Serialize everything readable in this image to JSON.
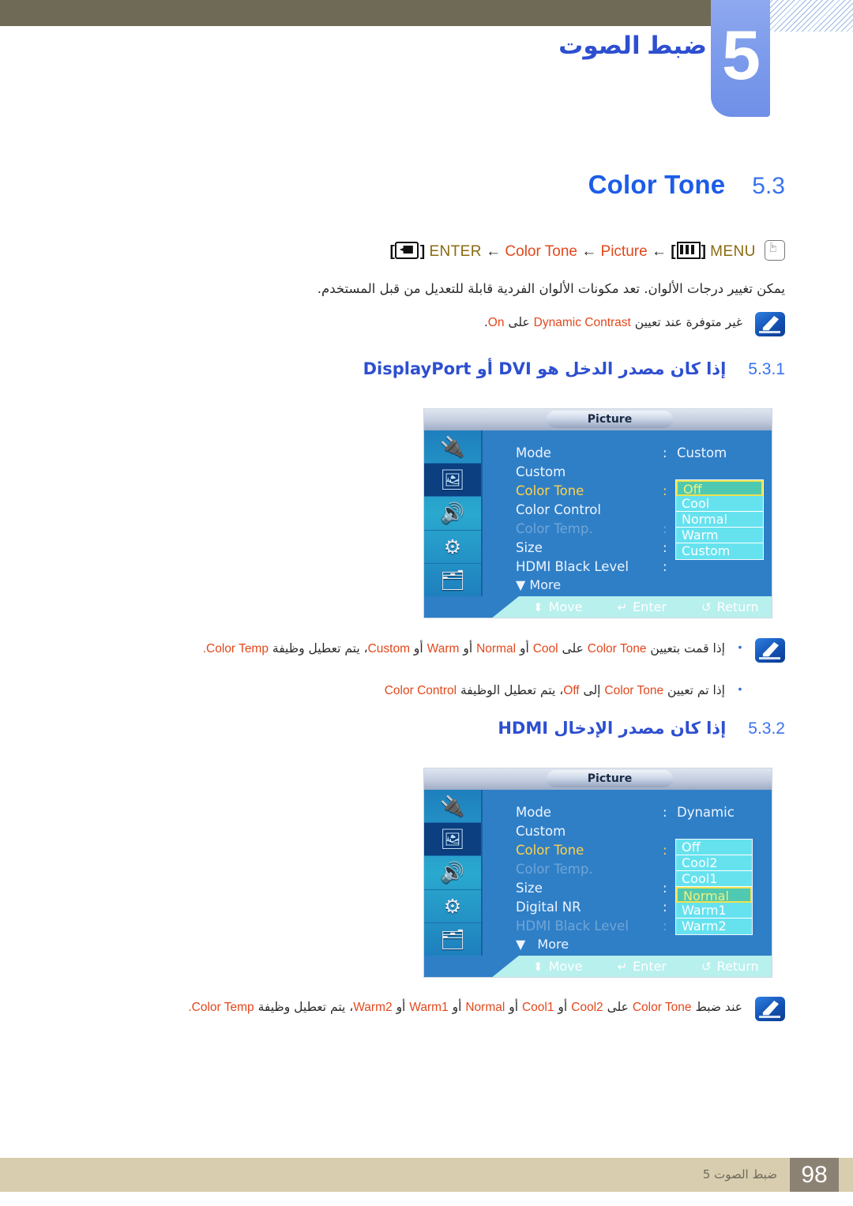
{
  "header": {
    "chapter_number": "5",
    "chapter_title": "ضبط الصوت"
  },
  "section": {
    "title": "Color Tone",
    "number": "5.3"
  },
  "menu_path": {
    "enter_icon": "enter-key-icon",
    "enter_label": "ENTER",
    "arrow1": "←",
    "item1": "Color Tone",
    "arrow2": "←",
    "item2": "Picture",
    "arrow3": "←",
    "menu_icon": "menu-key-icon",
    "menu_label": "MENU",
    "hand_icon": "hand-pointer-icon"
  },
  "intro_paragraph": "يمكن تغيير درجات الألوان. تعد مكونات الألوان الفردية قابلة للتعديل من قبل المستخدم.",
  "intro_note": {
    "icon": "note-pen-icon",
    "prefix_ar": "غير متوفرة عند تعيين",
    "term_en": "Dynamic Contrast",
    "mid_ar": "على",
    "value_en": "On",
    "suffix": "."
  },
  "subsection_1": {
    "number": "5.3.1",
    "title": "إذا كان مصدر الدخل هو DVI أو DisplayPort"
  },
  "osd_1": {
    "title": "Picture",
    "sidebar": [
      {
        "name": "input-source-icon",
        "glyph": "🔌",
        "active": false
      },
      {
        "name": "picture-icon",
        "glyph": "🖼",
        "active": true
      },
      {
        "name": "sound-icon",
        "glyph": "🔊",
        "active": false
      },
      {
        "name": "setup-gear-icon",
        "glyph": "⚙",
        "active": false
      },
      {
        "name": "multi-control-icon",
        "glyph": "🗂",
        "active": false
      }
    ],
    "rows": [
      {
        "label": "Mode",
        "colon": ":",
        "value": "Custom",
        "state": "normal"
      },
      {
        "label": "Custom",
        "colon": "",
        "value": "",
        "state": "normal"
      },
      {
        "label": "Color Tone",
        "colon": ":",
        "value": "",
        "state": "selected"
      },
      {
        "label": "Color Control",
        "colon": "",
        "value": "",
        "state": "normal"
      },
      {
        "label": "Color Temp.",
        "colon": ":",
        "value": "",
        "state": "dim"
      },
      {
        "label": "Size",
        "colon": ":",
        "value": "",
        "state": "normal"
      },
      {
        "label": "HDMI Black Level",
        "colon": ":",
        "value": "",
        "state": "normal"
      }
    ],
    "more_label": "More",
    "more_caret": "▼",
    "dropdown": [
      {
        "label": "Off",
        "highlighted": true
      },
      {
        "label": "Cool",
        "highlighted": false
      },
      {
        "label": "Normal",
        "highlighted": false
      },
      {
        "label": "Warm",
        "highlighted": false
      },
      {
        "label": "Custom",
        "highlighted": false
      }
    ],
    "footer": [
      {
        "icon": "up-down-arrow-icon",
        "glyph": "⬍",
        "label": "Move"
      },
      {
        "icon": "enter-icon",
        "glyph": "↵",
        "label": "Enter"
      },
      {
        "icon": "return-icon",
        "glyph": "↺",
        "label": "Return"
      }
    ]
  },
  "bullets_1": [
    {
      "icon": "note-pen-icon",
      "dot": "•",
      "parts": {
        "p1": "إذا قمت بتعيين",
        "t1": "Color Tone",
        "p2": "على",
        "t2": "Cool",
        "p3": "أو",
        "t3": "Normal",
        "p4": "أو",
        "t4": "Warm",
        "p5": "أو",
        "t5": "Custom",
        "p6": "، يتم تعطيل وظيفة",
        "t6": "Color Temp.",
        "p7": ""
      }
    },
    {
      "icon": "",
      "dot": "•",
      "parts": {
        "p1": "إذا تم تعيين",
        "t1": "Color Tone",
        "p2": "إلى",
        "t2": "Off",
        "p3": "، يتم تعطيل الوظيفة",
        "t3": "Color Control",
        "p4": ""
      }
    }
  ],
  "subsection_2": {
    "number": "5.3.2",
    "title": "إذا كان مصدر الإدخال HDMI"
  },
  "osd_2": {
    "title": "Picture",
    "sidebar": [
      {
        "name": "input-source-icon",
        "glyph": "🔌",
        "active": false
      },
      {
        "name": "picture-icon",
        "glyph": "🖼",
        "active": true
      },
      {
        "name": "sound-icon",
        "glyph": "🔊",
        "active": false
      },
      {
        "name": "setup-gear-icon",
        "glyph": "⚙",
        "active": false
      },
      {
        "name": "multi-control-icon",
        "glyph": "🗂",
        "active": false
      }
    ],
    "rows": [
      {
        "label": "Mode",
        "colon": ":",
        "value": "Dynamic",
        "state": "normal"
      },
      {
        "label": "Custom",
        "colon": "",
        "value": "",
        "state": "normal"
      },
      {
        "label": "Color Tone",
        "colon": ":",
        "value": "",
        "state": "selected"
      },
      {
        "label": "Color Temp.",
        "colon": "",
        "value": "",
        "state": "dim"
      },
      {
        "label": "Size",
        "colon": ":",
        "value": "",
        "state": "normal"
      },
      {
        "label": "Digital NR",
        "colon": ":",
        "value": "",
        "state": "normal"
      },
      {
        "label": "HDMI Black Level",
        "colon": ":",
        "value": "",
        "state": "dim"
      }
    ],
    "more_label": "More",
    "more_caret": "▼",
    "dropdown": [
      {
        "label": "Off",
        "highlighted": false
      },
      {
        "label": "Cool2",
        "highlighted": false
      },
      {
        "label": "Cool1",
        "highlighted": false
      },
      {
        "label": "Normal",
        "highlighted": true
      },
      {
        "label": "Warm1",
        "highlighted": false
      },
      {
        "label": "Warm2",
        "highlighted": false
      }
    ],
    "footer": [
      {
        "icon": "up-down-arrow-icon",
        "glyph": "⬍",
        "label": "Move"
      },
      {
        "icon": "enter-icon",
        "glyph": "↵",
        "label": "Enter"
      },
      {
        "icon": "return-icon",
        "glyph": "↺",
        "label": "Return"
      }
    ]
  },
  "bottom_note": {
    "icon": "note-pen-icon",
    "parts": {
      "p1": "عند ضبط",
      "t1": "Color Tone",
      "p2": "على",
      "t2": "Cool2",
      "p3": "أو",
      "t3": "Cool1",
      "p4": "أو",
      "t4": "Normal",
      "p5": "أو",
      "t5": "Warm1",
      "p6": "أو",
      "t6": "Warm2",
      "p7": "، يتم تعطيل وظيفة",
      "t7": "Color Temp.",
      "p8": ""
    }
  },
  "footer": {
    "page_number": "98",
    "chapter_label": "ضبط الصوت 5"
  },
  "colors": {
    "band": "#6e6a55",
    "chapter_tab": "#7f9dec",
    "heading_blue": "#1c5ce8",
    "term_orange": "#e2481c",
    "keyword_gold": "#8a6a10",
    "footer_bar": "#d8cdae",
    "footer_num_bg": "#8c8274",
    "osd_blue": "#2f7fc7",
    "osd_dropdown": "#66e2ef",
    "osd_highlight": "#4fc9b0"
  }
}
